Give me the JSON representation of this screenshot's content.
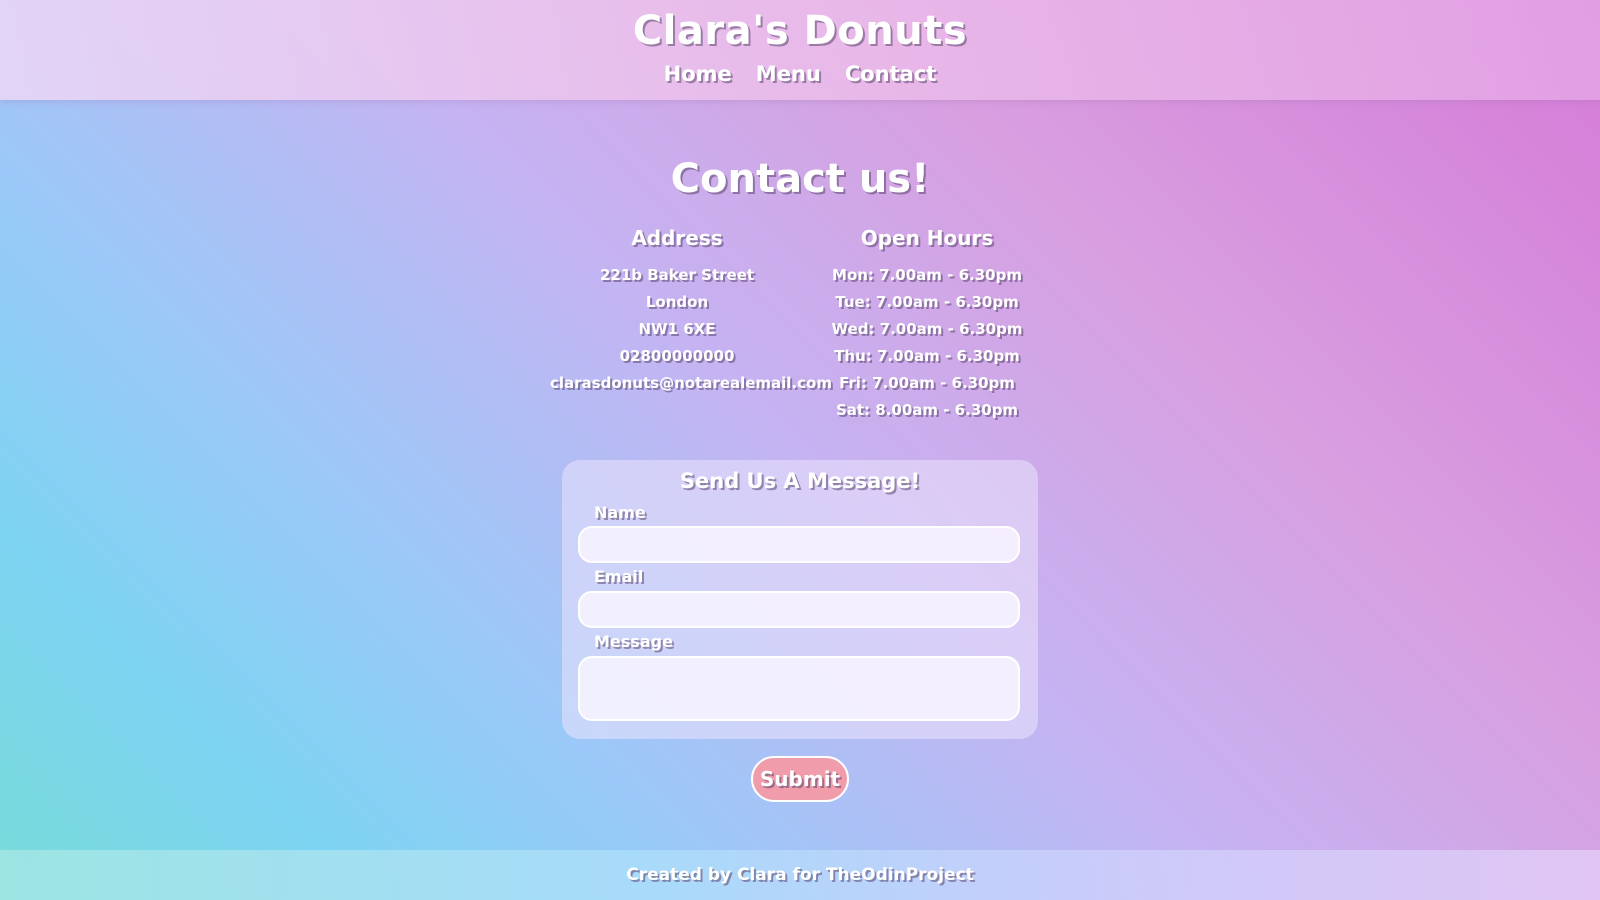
{
  "header": {
    "title": "Clara's Donuts",
    "nav": [
      "Home",
      "Menu",
      "Contact"
    ]
  },
  "main": {
    "heading": "Contact us!",
    "address": {
      "heading": "Address",
      "lines": [
        "221b Baker Street",
        "London",
        "NW1 6XE",
        "02800000000",
        "clarasdonuts@notarealemail.com"
      ]
    },
    "hours": {
      "heading": "Open Hours",
      "lines": [
        "Mon: 7.00am - 6.30pm",
        "Tue: 7.00am - 6.30pm",
        "Wed: 7.00am - 6.30pm",
        "Thu: 7.00am - 6.30pm",
        "Fri: 7.00am - 6.30pm",
        "Sat: 8.00am - 6.30pm"
      ]
    },
    "form": {
      "title": "Send Us A Message!",
      "name_label": "Name",
      "name_value": "",
      "email_label": "Email",
      "email_value": "",
      "message_label": "Message",
      "message_value": "",
      "submit_label": "Submit"
    }
  },
  "footer": {
    "text": "Created by Clara for TheOdinProject"
  },
  "colors": {
    "submit_button": "#f19cab",
    "text": "#ffffff"
  }
}
